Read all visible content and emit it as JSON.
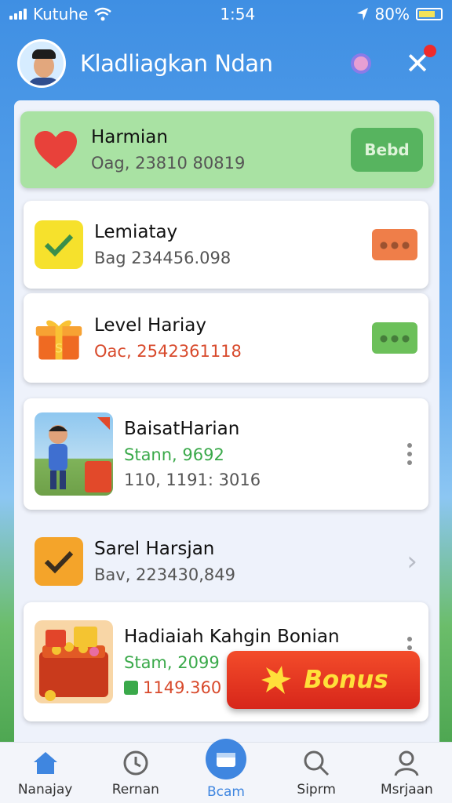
{
  "status_bar": {
    "carrier": "Kutuhe",
    "time": "1:54",
    "battery": "80%"
  },
  "header": {
    "title": "Kladliagkan Ndan"
  },
  "cards": [
    {
      "title": "Harmian",
      "subtitle": "Oag, 23810 80819",
      "action": "Bebd"
    },
    {
      "title": "Lemiatay",
      "subtitle": "Bag 234456.098"
    },
    {
      "title": "Level Hariay",
      "subtitle": "Oac, 2542361118"
    },
    {
      "title": "BaisatHarian",
      "subtitle": "Stann, 9692",
      "detail": "110, 1191: 3016"
    },
    {
      "title": "Sarel Harsjan",
      "subtitle": "Bav, 223430,849"
    },
    {
      "title": "Hadiaiah Kahgin Bonian",
      "subtitle": "Stam, 2099",
      "detail": "1149.360"
    }
  ],
  "bonus": {
    "label": "Bonus"
  },
  "tabs": [
    {
      "label": "Nanajay",
      "icon": "home-icon"
    },
    {
      "label": "Rernan",
      "icon": "clock-icon"
    },
    {
      "label": "Bcam",
      "icon": "wallet-icon"
    },
    {
      "label": "Siprm",
      "icon": "search-icon"
    },
    {
      "label": "Msrjaan",
      "icon": "profile-icon"
    }
  ],
  "colors": {
    "header_blue": "#3f8fe3",
    "highlight_green": "#a9e2a3",
    "bonus_red": "#e33a20",
    "bonus_text": "#ffe03a",
    "active_tab": "#3f86e0"
  }
}
